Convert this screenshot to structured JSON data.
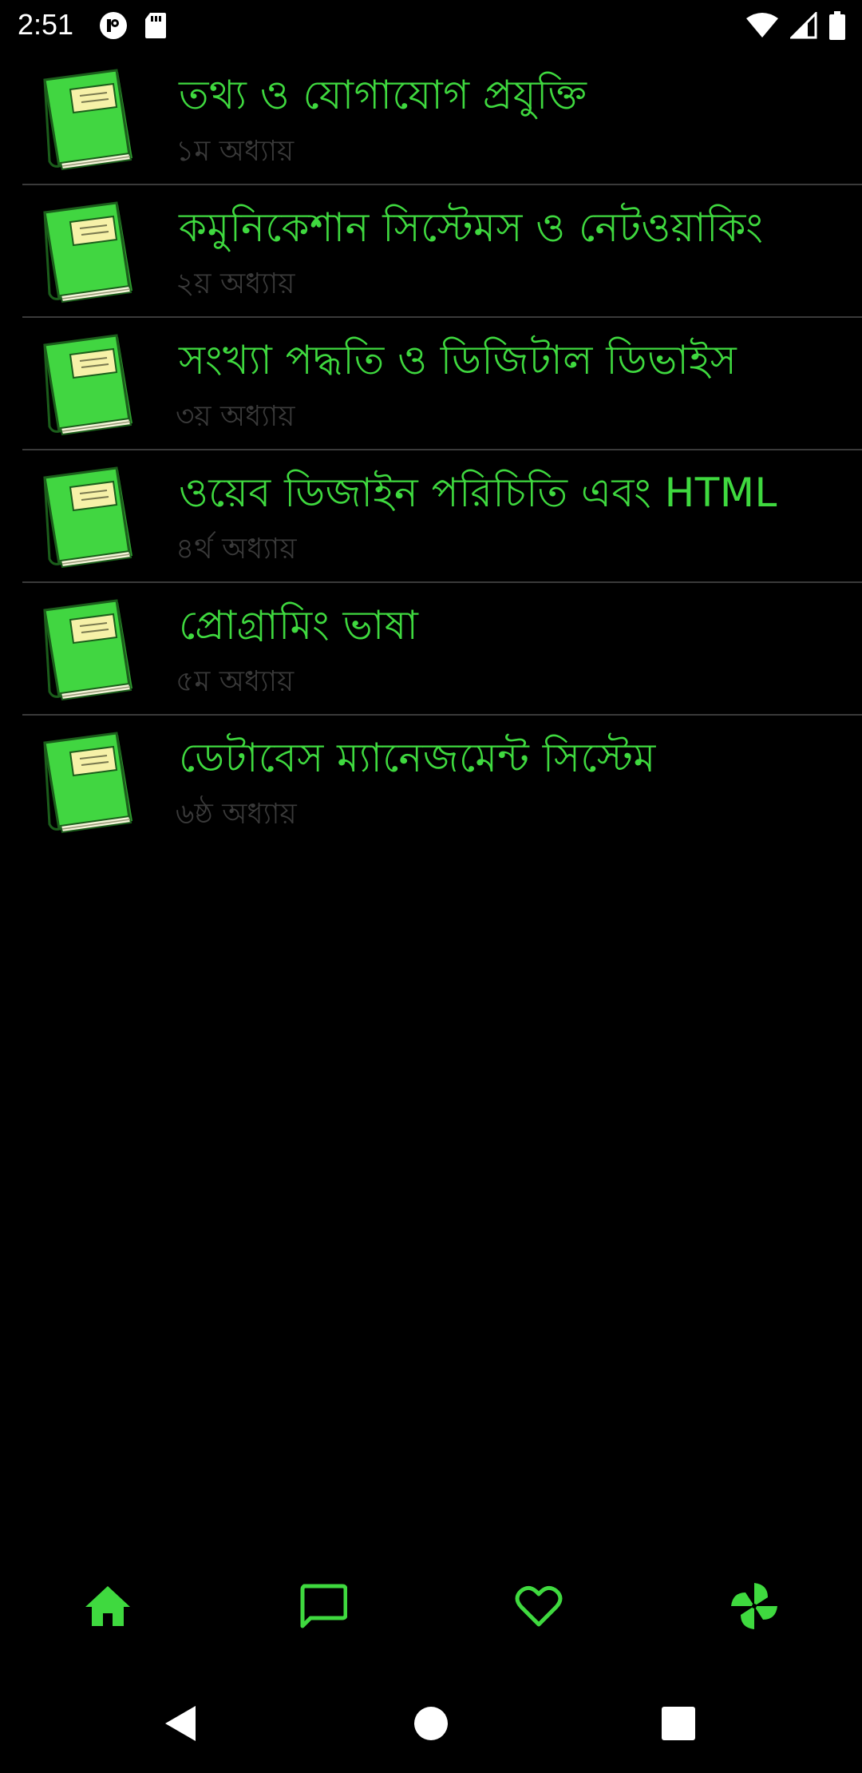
{
  "status_bar": {
    "time": "2:51",
    "left_icons": [
      "p-badge-icon",
      "sd-card-icon"
    ],
    "right_icons": [
      "wifi-icon",
      "cell-signal-icon",
      "battery-icon"
    ]
  },
  "chapters": [
    {
      "title": "তথ্য ও যোগাযোগ প্রযুক্তি",
      "subtitle": "১ম অধ্যায়"
    },
    {
      "title": "কমুনিকেশান সিস্টেমস ও নেটওয়াকিং",
      "subtitle": "২য় অধ্যায়"
    },
    {
      "title": "সংখ্যা পদ্ধতি ও ডিজিটাল ডিভাইস",
      "subtitle": "৩য় অধ্যায়"
    },
    {
      "title": "ওয়েব ডিজাইন পরিচিতি এবং HTML",
      "subtitle": "৪র্থ অধ্যায়"
    },
    {
      "title": "প্রোগ্রামিং ভাষা",
      "subtitle": "৫ম অধ্যায়"
    },
    {
      "title": "ডেটাবেস ম্যানেজমেন্ট সিস্টেম",
      "subtitle": "৬ষ্ঠ অধ্যায়"
    }
  ],
  "bottom_nav": {
    "items": [
      "home-icon",
      "chat-icon",
      "heart-icon",
      "pinwheel-icon"
    ]
  },
  "colors": {
    "accent": "#3fd93f",
    "background": "#000000",
    "subtitle": "#3a3a3a",
    "divider": "#3a3a3a"
  }
}
